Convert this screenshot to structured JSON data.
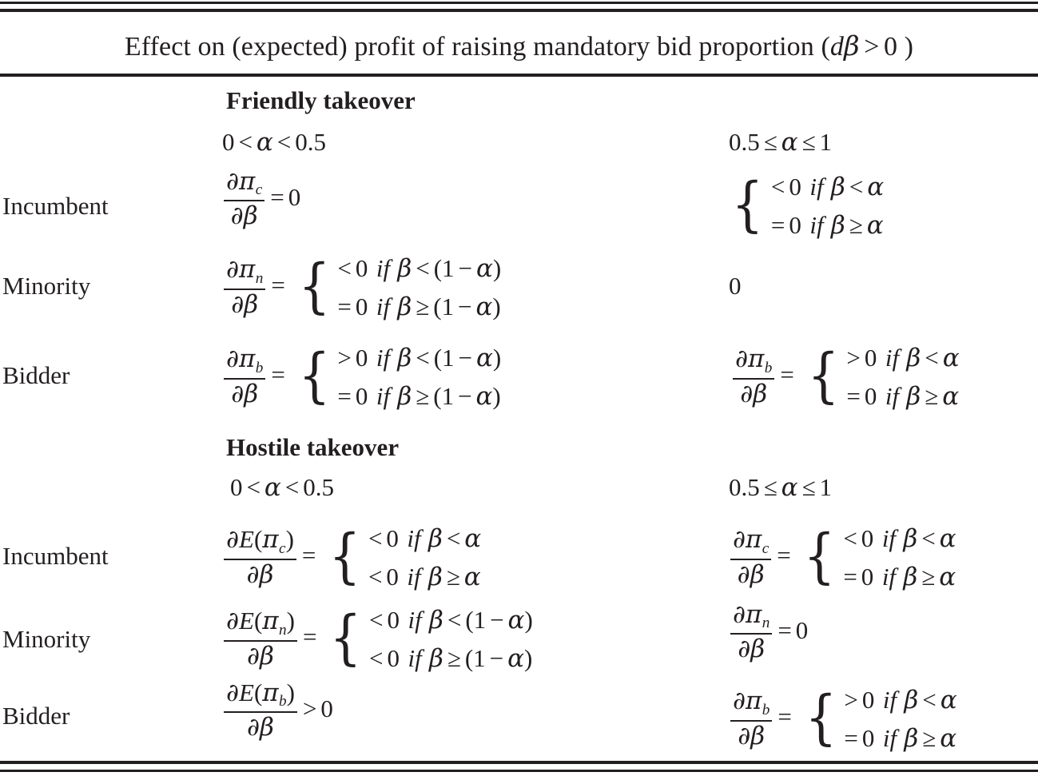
{
  "table": {
    "caption": "Effect on (expected) profit of raising mandatory bid proportion (dβ > 0 )",
    "sections": [
      {
        "id": "friendly",
        "heading": "Friendly takeover",
        "column_headers": [
          "0 < α < 0.5",
          "0.5 ≤ α ≤ 1"
        ],
        "rows": [
          {
            "label": "Incumbent",
            "left": {
              "kind": "equation",
              "lhs_num": "∂π_c",
              "lhs_den": "∂β",
              "relation": "=",
              "rhs": "0",
              "text": "∂π_c/∂β = 0"
            },
            "right": {
              "kind": "cases_only",
              "cases": [
                {
                  "value": "< 0",
                  "cond": "if  β < α"
                },
                {
                  "value": "= 0",
                  "cond": "if  β ≥ α"
                }
              ],
              "text": "{ < 0 if β < α ; = 0 if β ≥ α }"
            }
          },
          {
            "label": "Minority",
            "left": {
              "kind": "frac_cases",
              "lhs_num": "∂π_n",
              "lhs_den": "∂β",
              "relation": "=",
              "cases": [
                {
                  "value": "< 0",
                  "cond": "if  β < (1 − α)"
                },
                {
                  "value": "= 0",
                  "cond": "if  β ≥ (1 − α)"
                }
              ],
              "text": "∂π_n/∂β = { < 0 if β < (1 − α) ; = 0 if β ≥ (1 − α) }"
            },
            "right": {
              "kind": "plain",
              "text": "0"
            }
          },
          {
            "label": "Bidder",
            "left": {
              "kind": "frac_cases",
              "lhs_num": "∂π_b",
              "lhs_den": "∂β",
              "relation": "=",
              "cases": [
                {
                  "value": "> 0",
                  "cond": "if  β < (1 − α)"
                },
                {
                  "value": "= 0",
                  "cond": "if  β ≥ (1 − α)"
                }
              ],
              "text": "∂π_b/∂β = { > 0 if β < (1 − α) ; = 0 if β ≥ (1 − α) }"
            },
            "right": {
              "kind": "frac_cases",
              "lhs_num": "∂π_b",
              "lhs_den": "∂β",
              "relation": "=",
              "cases": [
                {
                  "value": "> 0",
                  "cond": "if  β < α"
                },
                {
                  "value": "= 0",
                  "cond": "if  β ≥ α"
                }
              ],
              "text": "∂π_b/∂β = { > 0 if β < α ; = 0 if β ≥ α }"
            }
          }
        ]
      },
      {
        "id": "hostile",
        "heading": "Hostile takeover",
        "column_headers": [
          "0 < α < 0.5",
          "0.5 ≤ α ≤ 1"
        ],
        "rows": [
          {
            "label": "Incumbent",
            "left": {
              "kind": "frac_cases",
              "lhs_num": "∂E(π_c)",
              "lhs_den": "∂β",
              "relation": "=",
              "cases": [
                {
                  "value": "< 0",
                  "cond": "if  β < α"
                },
                {
                  "value": "< 0",
                  "cond": "if  β ≥ α"
                }
              ],
              "text": "∂E(π_c)/∂β = { < 0 if β < α ; < 0 if β ≥ α }"
            },
            "right": {
              "kind": "frac_cases",
              "lhs_num": "∂π_c",
              "lhs_den": "∂β",
              "relation": "=",
              "cases": [
                {
                  "value": "< 0",
                  "cond": "if  β < α"
                },
                {
                  "value": "= 0",
                  "cond": "if  β ≥ α"
                }
              ],
              "text": "∂π_c/∂β = { < 0 if β < α ; = 0 if β ≥ α }"
            }
          },
          {
            "label": "Minority",
            "left": {
              "kind": "frac_cases",
              "lhs_num": "∂E(π_n)",
              "lhs_den": "∂β",
              "relation": "=",
              "cases": [
                {
                  "value": "< 0",
                  "cond": "if  β < (1 − α)"
                },
                {
                  "value": "< 0",
                  "cond": "if  β ≥ (1 − α)"
                }
              ],
              "text": "∂E(π_n)/∂β = { < 0 if β < (1 − α) ; < 0 if β ≥ (1 − α) }"
            },
            "right": {
              "kind": "equation",
              "lhs_num": "∂π_n",
              "lhs_den": "∂β",
              "relation": "=",
              "rhs": "0",
              "text": "∂π_n/∂β = 0"
            }
          },
          {
            "label": "Bidder",
            "left": {
              "kind": "equation",
              "lhs_num": "∂E(π_b)",
              "lhs_den": "∂β",
              "relation": ">",
              "rhs": "0",
              "text": "∂E(π_b)/∂β > 0"
            },
            "right": {
              "kind": "frac_cases",
              "lhs_num": "∂π_b",
              "lhs_den": "∂β",
              "relation": "=",
              "cases": [
                {
                  "value": "> 0",
                  "cond": "if  β < α"
                },
                {
                  "value": "= 0",
                  "cond": "if  β ≥ α"
                }
              ],
              "text": "∂π_b/∂β = { > 0 if β < α ; = 0 if β ≥ α }"
            }
          }
        ]
      }
    ],
    "colors": {
      "ink": "#231f20",
      "paper": "#ffffff"
    }
  }
}
